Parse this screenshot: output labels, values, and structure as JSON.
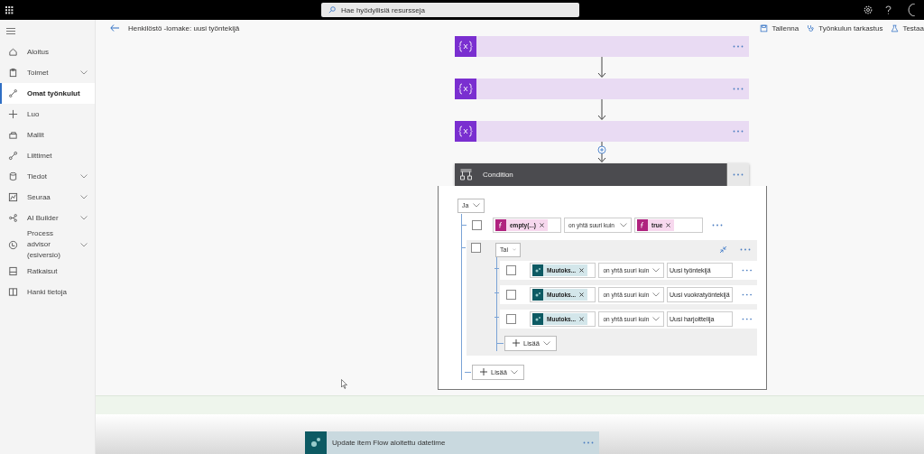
{
  "top_bar": {
    "search_placeholder": "Hae hyödyllisiä resursseja"
  },
  "sidebar": {
    "items": [
      {
        "label": "Aloitus",
        "selected": false,
        "expandable": false
      },
      {
        "label": "Toimet",
        "selected": false,
        "expandable": true
      },
      {
        "label": "Omat työnkulut",
        "selected": true,
        "expandable": false
      },
      {
        "label": "Luo",
        "selected": false,
        "expandable": false
      },
      {
        "label": "Mallit",
        "selected": false,
        "expandable": false
      },
      {
        "label": "Liittimet",
        "selected": false,
        "expandable": false
      },
      {
        "label": "Tiedot",
        "selected": false,
        "expandable": true
      },
      {
        "label": "Seuraa",
        "selected": false,
        "expandable": true
      },
      {
        "label": "AI Builder",
        "selected": false,
        "expandable": true
      },
      {
        "label": "Process advisor (esiversio)",
        "selected": false,
        "expandable": true
      },
      {
        "label": "Ratkaisut",
        "selected": false,
        "expandable": false
      },
      {
        "label": "Hanki tietoja",
        "selected": false,
        "expandable": false
      }
    ]
  },
  "header": {
    "title": "Henkilöstö -lomake: uusi työntekijä",
    "actions": [
      {
        "label": "Tallenna"
      },
      {
        "label": "Työnkulun tarkastus"
      },
      {
        "label": "Testaa"
      }
    ]
  },
  "steps": [
    {
      "kind": "variable"
    },
    {
      "kind": "variable"
    },
    {
      "kind": "variable"
    }
  ],
  "condition": {
    "title": "Condition",
    "operator": "Ja",
    "add_label": "Lisää",
    "rows": [
      {
        "kind": "row",
        "checked": false,
        "left": {
          "kind": "expression",
          "text": "empty(...)"
        },
        "operator": "on yhtä suuri kuin",
        "right": {
          "kind": "expression",
          "text": "true"
        }
      },
      {
        "kind": "group",
        "checked": false,
        "operator": "Tai",
        "add_label": "Lisää",
        "rows": [
          {
            "kind": "row",
            "checked": false,
            "left": {
              "kind": "dynamic",
              "text": "Muutoks..."
            },
            "operator": "on yhtä suuri kuin",
            "right": {
              "kind": "text",
              "text": "Uusi työntekijä"
            }
          },
          {
            "kind": "row",
            "checked": false,
            "left": {
              "kind": "dynamic",
              "text": "Muutoks..."
            },
            "operator": "on yhtä suuri kuin",
            "right": {
              "kind": "text",
              "text": "Uusi vuokratyöntekijä"
            }
          },
          {
            "kind": "row",
            "checked": false,
            "left": {
              "kind": "dynamic",
              "text": "Muutoks..."
            },
            "operator": "on yhtä suuri kuin",
            "right": {
              "kind": "text",
              "text": "Uusi harjoittelija"
            }
          }
        ]
      }
    ]
  },
  "next_step": {
    "title": "Update item Flow aloitettu datetime"
  }
}
